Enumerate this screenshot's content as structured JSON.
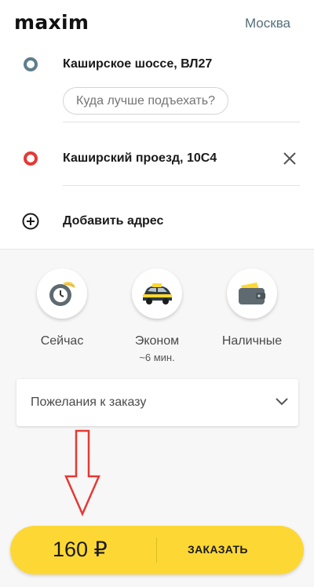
{
  "header": {
    "logo": "maxim",
    "city": "Москва"
  },
  "route": {
    "from": {
      "address": "Каширское шоссе, ВЛ27",
      "hint_placeholder": "Куда лучше подъехать?"
    },
    "to": {
      "address": "Каширский проезд, 10С4"
    },
    "add_label": "Добавить адрес"
  },
  "options": [
    {
      "label": "Сейчас",
      "icon": "clock-icon"
    },
    {
      "label": "Эконом",
      "sub": "~6 мин.",
      "icon": "taxi-car-icon"
    },
    {
      "label": "Наличные",
      "icon": "wallet-icon"
    }
  ],
  "wishes": {
    "label": "Пожелания к заказу"
  },
  "order": {
    "price": "160 ₽",
    "button": "ЗАКАЗАТЬ"
  },
  "colors": {
    "accent": "#fdd835",
    "from_dot": "#607d8b",
    "to_dot": "#e53935",
    "annotation_arrow": "#e53935"
  }
}
